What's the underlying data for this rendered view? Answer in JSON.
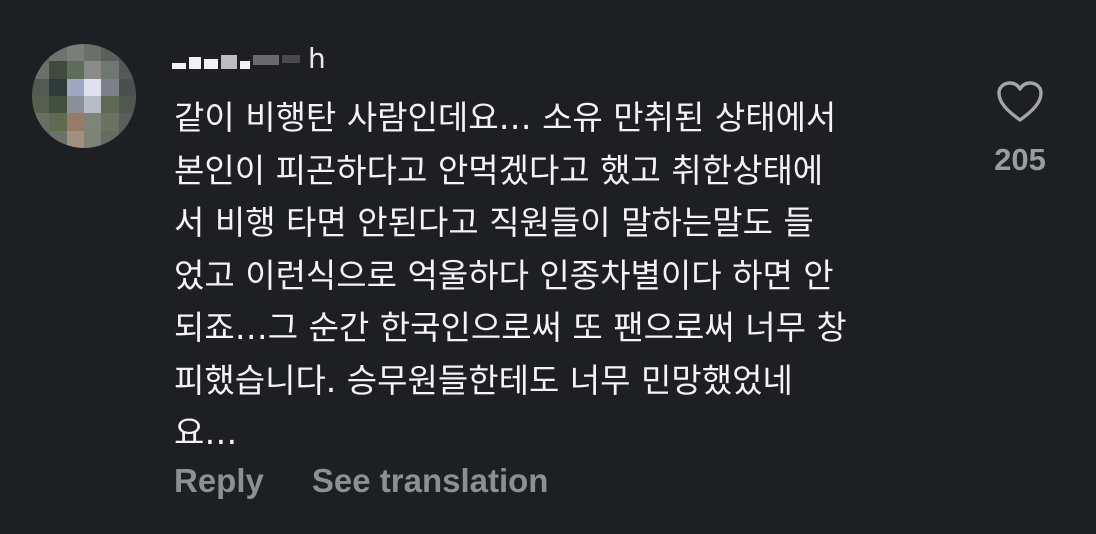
{
  "comment": {
    "username": "h",
    "text": "같이 비행탄 사람인데요… 소유 만취된 상태에서\n본인이 피곤하다고 안먹겠다고 했고 취한상태에\n서 비행 타면 안된다고 직원들이 말하는말도 들\n었고 이런식으로 억울하다 인종차별이다 하면 안\n되죠…그 순간 한국인으로써 또 팬으로써 너무 창\n피했습니다. 승무원들한테도 너무 민망했었네\n요…",
    "reply_label": "Reply",
    "translate_label": "See translation",
    "like_count": "205",
    "like_icon": "heart-outline-icon",
    "avatar_image": "blurred-profile-photo"
  },
  "colors": {
    "background": "#1e1f23",
    "text": "#f4f4f4",
    "secondary_text": "#8d8f96",
    "like_icon": "#a3a5ab"
  }
}
